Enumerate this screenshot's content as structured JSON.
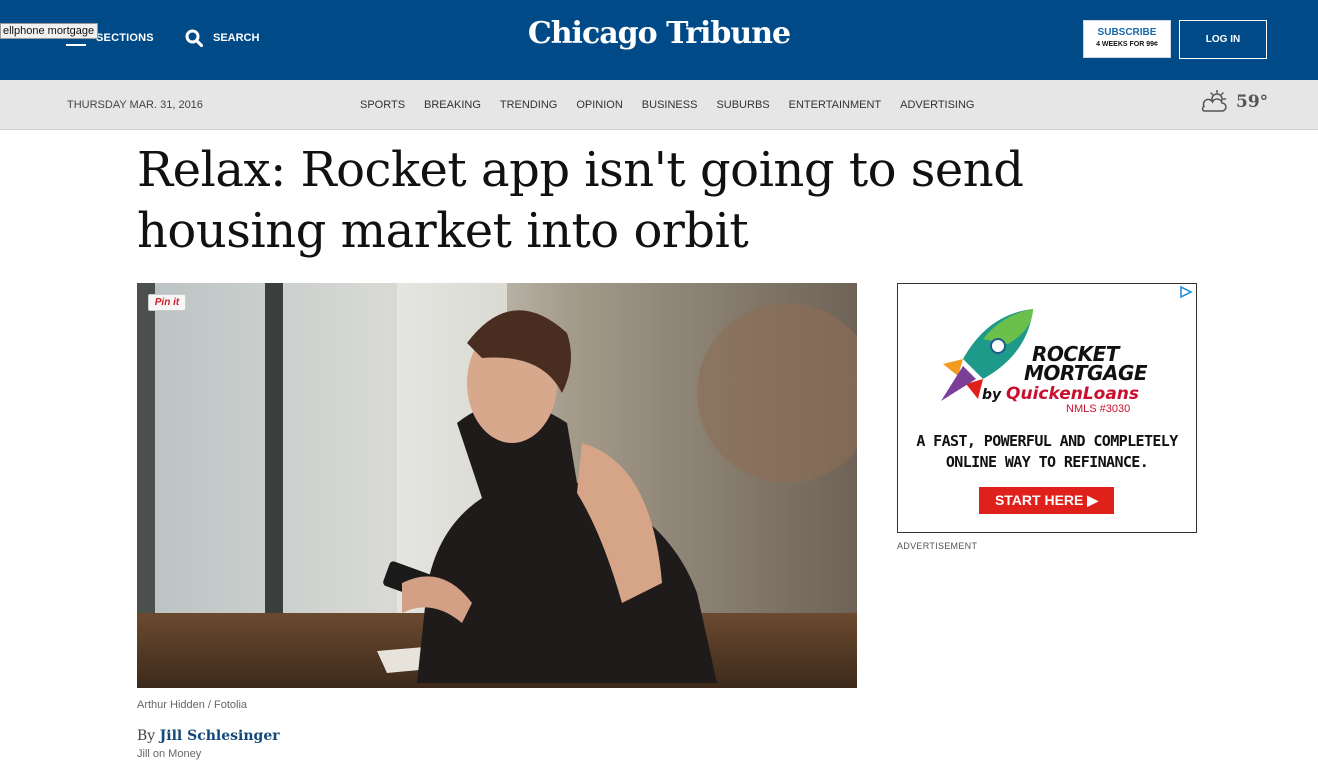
{
  "tooltip": "ellphone mortgage",
  "header": {
    "sections_label": "SECTIONS",
    "search_label": "SEARCH",
    "logo_text": "Chicago Tribune",
    "subscribe_label": "SUBSCRIBE",
    "subscribe_offer": "4 WEEKS FOR 99¢",
    "login_label": "LOG IN",
    "brand_color": "#004a87"
  },
  "navbar": {
    "date": "THURSDAY MAR. 31, 2016",
    "items": [
      "SPORTS",
      "BREAKING",
      "TRENDING",
      "OPINION",
      "BUSINESS",
      "SUBURBS",
      "ENTERTAINMENT",
      "ADVERTISING"
    ],
    "weather_icon": "partly-cloudy-icon",
    "temperature": "59°"
  },
  "article": {
    "headline": "Relax: Rocket app isn't going to send housing market into orbit",
    "pin_label": "Pin it",
    "photo_credit": "Arthur Hidden / Fotolia",
    "byline_prefix": "By",
    "author": "Jill Schlesinger",
    "column": "Jill on Money"
  },
  "ad": {
    "brand_line1": "ROCKET",
    "brand_line2": "MORTGAGE",
    "by_text": "by",
    "partner": "QuickenLoans",
    "nmls": "NMLS #3030",
    "tagline1": "A FAST, POWERFUL AND COMPLETELY",
    "tagline2": "ONLINE WAY TO REFINANCE.",
    "cta": "START HERE",
    "label": "ADVERTISEMENT",
    "cta_color": "#e0211b"
  }
}
